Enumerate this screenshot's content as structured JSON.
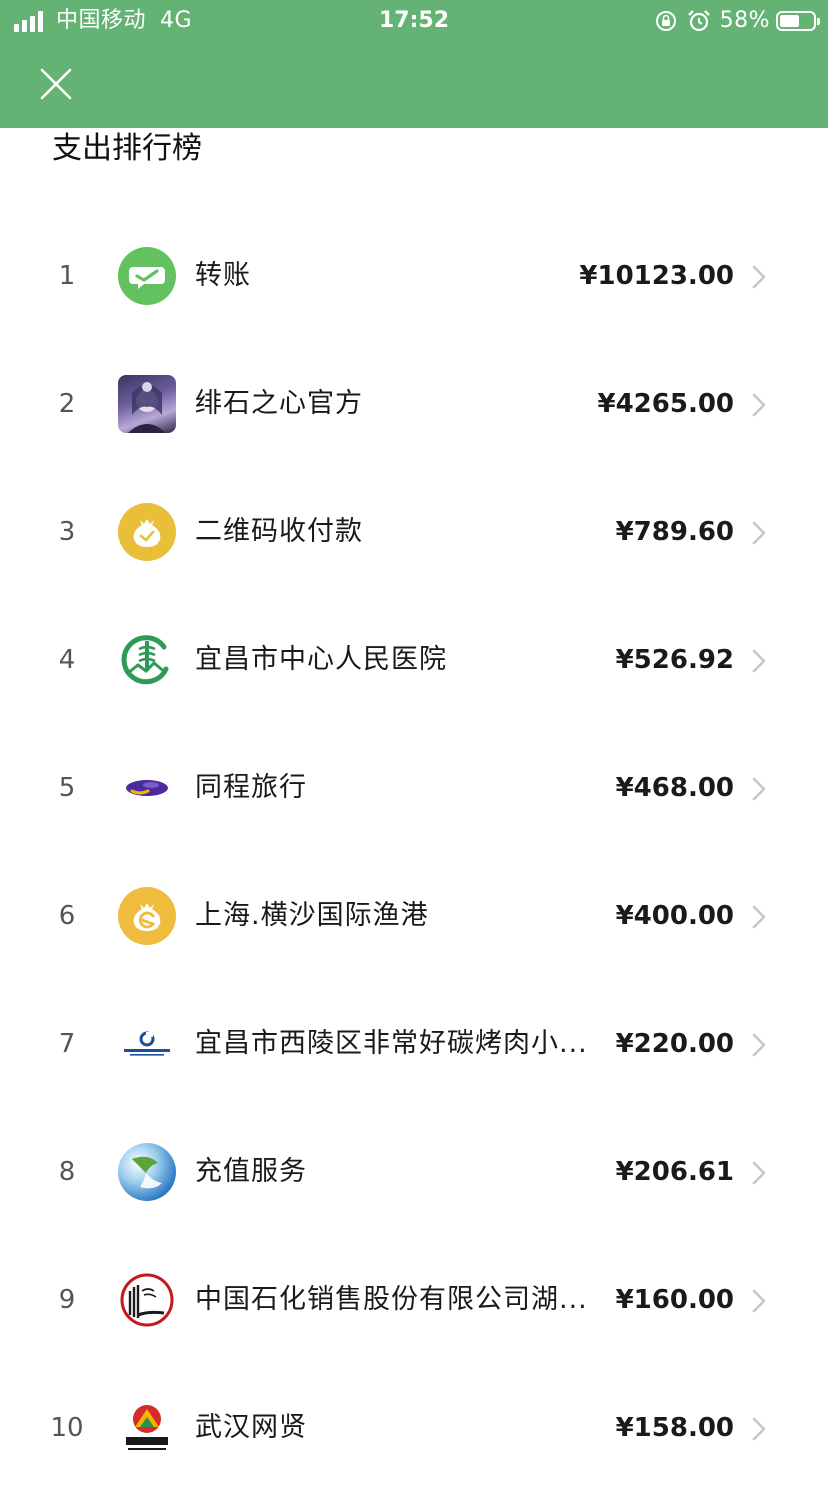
{
  "status_bar": {
    "carrier": "中国移动",
    "network": "4G",
    "time": "17:52",
    "battery": "58%",
    "battery_level": 0.58
  },
  "nav": {
    "close_icon": "close-icon"
  },
  "page": {
    "title": "支出排行榜"
  },
  "colors": {
    "header_bg": "#64b374",
    "wechat_green": "#63c15f",
    "payment_gold": "#e9bf3a",
    "hospital_green": "#2e9a55",
    "tongcheng_purple": "#4a2a9c",
    "ccb_blue": "#1d4f9a",
    "sinopec_red": "#c8161d"
  },
  "ranking": [
    {
      "rank": "1",
      "name": "转账",
      "amount": "¥10123.00",
      "icon": "wechat-transfer-icon"
    },
    {
      "rank": "2",
      "name": "绯石之心官方",
      "amount": "¥4265.00",
      "icon": "game-avatar-icon"
    },
    {
      "rank": "3",
      "name": "二维码收付款",
      "amount": "¥789.60",
      "icon": "qr-payment-icon"
    },
    {
      "rank": "4",
      "name": "宜昌市中心人民医院",
      "amount": "¥526.92",
      "icon": "hospital-logo-icon"
    },
    {
      "rank": "5",
      "name": "同程旅行",
      "amount": "¥468.00",
      "icon": "tongcheng-logo-icon"
    },
    {
      "rank": "6",
      "name": "上海.横沙国际渔港",
      "amount": "¥400.00",
      "icon": "merchant-payment-icon"
    },
    {
      "rank": "7",
      "name": "宜昌市西陵区非常好碳烤肉小...",
      "amount": "¥220.00",
      "icon": "ccb-logo-icon"
    },
    {
      "rank": "8",
      "name": "充值服务",
      "amount": "¥206.61",
      "icon": "recharge-logo-icon"
    },
    {
      "rank": "9",
      "name": "中国石化销售股份有限公司湖...",
      "amount": "¥160.00",
      "icon": "sinopec-logo-icon"
    },
    {
      "rank": "10",
      "name": "武汉网贤",
      "amount": "¥158.00",
      "icon": "wuhan-wangxian-logo-icon"
    }
  ]
}
